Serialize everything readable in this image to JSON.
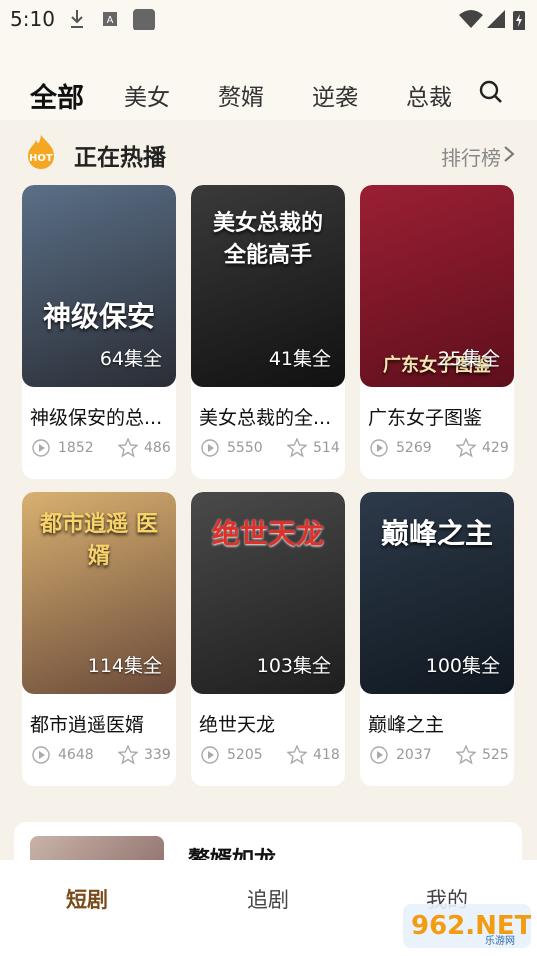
{
  "status": {
    "time": "5:10"
  },
  "tabs": [
    {
      "label": "全部",
      "active": true
    },
    {
      "label": "美女",
      "active": false
    },
    {
      "label": "赘婿",
      "active": false
    },
    {
      "label": "逆袭",
      "active": false
    },
    {
      "label": "总裁",
      "active": false
    }
  ],
  "section": {
    "badge": "HOT",
    "title": "正在热播",
    "more": "排行榜"
  },
  "dramas": [
    {
      "name": "神级保安的总...",
      "episodes": "64集全",
      "poster_text": "神级保安",
      "plays": "1852",
      "stars": "486",
      "color1": "#5a6f87",
      "color2": "#2a2d35"
    },
    {
      "name": "美女总裁的全...",
      "episodes": "41集全",
      "poster_text": "美女总裁的 全能高手",
      "plays": "5550",
      "stars": "514",
      "color1": "#3a3a3a",
      "color2": "#111111"
    },
    {
      "name": "广东女子图鉴",
      "episodes": "25集全",
      "poster_text": "广东女子图鉴",
      "plays": "5269",
      "stars": "429",
      "color1": "#9b1f34",
      "color2": "#5e0f1c"
    },
    {
      "name": "都市逍遥医婿",
      "episodes": "114集全",
      "poster_text": "都市逍遥 医婿",
      "plays": "4648",
      "stars": "339",
      "color1": "#d8b070",
      "color2": "#6a4a3a"
    },
    {
      "name": "绝世天龙",
      "episodes": "103集全",
      "poster_text": "绝世天龙",
      "plays": "5205",
      "stars": "418",
      "color1": "#4a4a4a",
      "color2": "#1e1e1e"
    },
    {
      "name": "巅峰之主",
      "episodes": "100集全",
      "poster_text": "巅峰之主",
      "plays": "2037",
      "stars": "525",
      "color1": "#2d3a4a",
      "color2": "#101820"
    }
  ],
  "featured": {
    "title": "赘婿如龙"
  },
  "nav": [
    {
      "label": "短剧",
      "active": true
    },
    {
      "label": "追剧",
      "active": false
    },
    {
      "label": "我的",
      "active": false
    }
  ],
  "watermark": {
    "text": "962.NET",
    "sub": "乐游网"
  }
}
